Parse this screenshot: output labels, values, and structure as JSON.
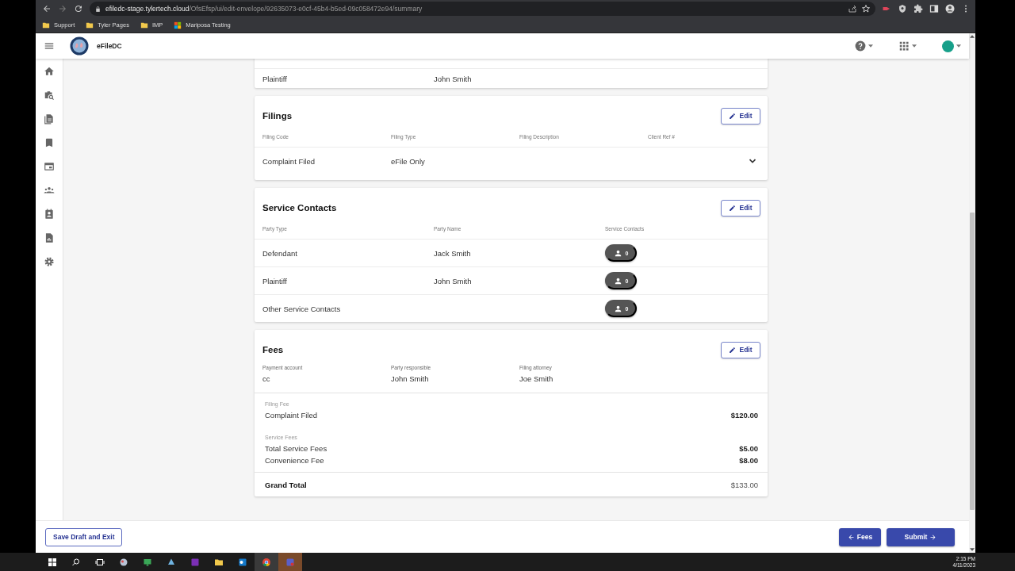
{
  "browser": {
    "url_host": "efiledc-stage.tylertech.cloud",
    "url_path": "/OfsEfsp/ui/edit-envelope/92635073-e0cf-45b4-b5ed-09c058472e94/summary",
    "bookmarks": [
      {
        "label": "Support",
        "kind": "folder"
      },
      {
        "label": "Tyler Pages",
        "kind": "folder"
      },
      {
        "label": "IMP",
        "kind": "folder"
      },
      {
        "label": "Mariposa Testing",
        "kind": "site"
      }
    ]
  },
  "app_header": {
    "title": "eFileDC"
  },
  "parties": {
    "rows": [
      {
        "party_type": "Plaintiff",
        "party_name": "John Smith"
      }
    ]
  },
  "filings": {
    "title": "Filings",
    "edit_button": "Edit",
    "columns": [
      "Filing Code",
      "Filing Type",
      "Filing Description",
      "Client Ref #"
    ],
    "rows": [
      {
        "filing_code": "Complaint Filed",
        "filing_type": "eFile Only",
        "expanded": false
      }
    ]
  },
  "service_contacts": {
    "title": "Service Contacts",
    "edit_button": "Edit",
    "columns": [
      "Party Type",
      "Party Name",
      "Service Contacts"
    ],
    "rows": [
      {
        "party_type": "Defendant",
        "party_name": "Jack Smith",
        "count": "0"
      },
      {
        "party_type": "Plaintiff",
        "party_name": "John Smith",
        "count": "0"
      },
      {
        "party_type": "Other Service Contacts",
        "count": "0"
      }
    ]
  },
  "fees": {
    "title": "Fees",
    "edit_button": "Edit",
    "details": [
      {
        "label": "Payment account",
        "value": "cc"
      },
      {
        "label": "Party responsible",
        "value": "John Smith"
      },
      {
        "label": "Filing attorney",
        "value": "Joe Smith"
      }
    ],
    "sections": [
      {
        "heading": "Filing Fee",
        "items": [
          {
            "label": "Complaint Filed",
            "amount": "$120.00"
          }
        ]
      },
      {
        "heading": "Service Fees",
        "items": [
          {
            "label": "Total Service Fees",
            "amount": "$5.00"
          },
          {
            "label": "Convenience Fee",
            "amount": "$8.00"
          }
        ]
      }
    ],
    "grand_total": {
      "label": "Grand Total",
      "amount": "$133.00"
    }
  },
  "footer": {
    "save_button": "Save Draft and Exit",
    "back_button": "Fees",
    "submit_button": "Submit"
  },
  "taskbar": {
    "time": "2:15 PM",
    "date": "4/11/2023"
  }
}
